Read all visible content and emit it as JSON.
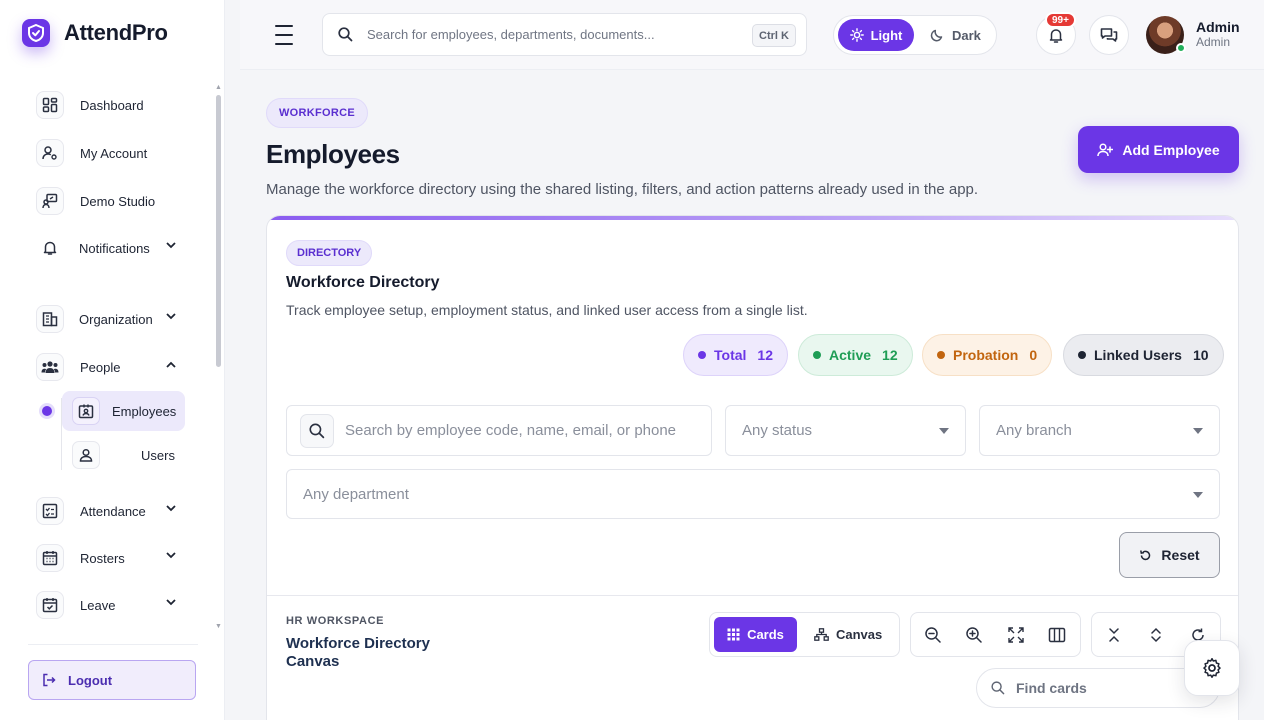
{
  "app": {
    "name": "AttendPro"
  },
  "sidebar": {
    "items": [
      {
        "label": "Dashboard",
        "icon": "dashboard-icon"
      },
      {
        "label": "My Account",
        "icon": "user-gear-icon"
      },
      {
        "label": "Demo Studio",
        "icon": "presentation-icon"
      },
      {
        "label": "Notifications",
        "icon": "bell-icon"
      },
      {
        "label": "Organization",
        "icon": "building-icon"
      },
      {
        "label": "People",
        "icon": "users-icon"
      },
      {
        "label": "Attendance",
        "icon": "checklist-icon"
      },
      {
        "label": "Rosters",
        "icon": "calendar-icon"
      },
      {
        "label": "Leave",
        "icon": "calendar-check-icon"
      }
    ],
    "people_sub": [
      {
        "label": "Employees",
        "active": true
      },
      {
        "label": "Users",
        "active": false
      }
    ],
    "logout_label": "Logout"
  },
  "topbar": {
    "search_placeholder": "Search for employees, departments, documents...",
    "shortcut": "Ctrl K",
    "theme_light": "Light",
    "theme_dark": "Dark",
    "notification_badge": "99+",
    "user_name": "Admin",
    "user_role": "Admin"
  },
  "page": {
    "eyebrow": "WORKFORCE",
    "title": "Employees",
    "subtitle": "Manage the workforce directory using the shared listing, filters, and action patterns already used in the app.",
    "add_button": "Add Employee"
  },
  "directory": {
    "eyebrow": "DIRECTORY",
    "title": "Workforce Directory",
    "subtitle": "Track employee setup, employment status, and linked user access from a single list.",
    "stats": [
      {
        "label": "Total",
        "value": "12",
        "color": "#6b36e6"
      },
      {
        "label": "Active",
        "value": "12",
        "color": "#1f9d55"
      },
      {
        "label": "Probation",
        "value": "0",
        "color": "#c2650f"
      },
      {
        "label": "Linked Users",
        "value": "10",
        "color": "#1e2433"
      }
    ],
    "filters": {
      "search_placeholder": "Search by employee code, name, email, or phone",
      "status": "Any status",
      "branch": "Any branch",
      "department": "Any department"
    },
    "reset_label": "Reset"
  },
  "workspace": {
    "eyebrow": "HR WORKSPACE",
    "title": "Workforce Directory Canvas",
    "view_cards": "Cards",
    "view_canvas": "Canvas",
    "find_placeholder": "Find cards"
  },
  "colors": {
    "accent": "#6b36e6"
  }
}
